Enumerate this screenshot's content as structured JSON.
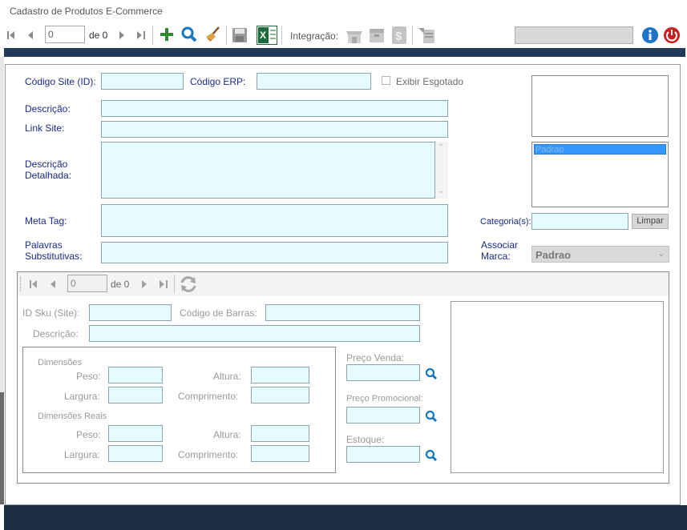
{
  "window": {
    "title": "Cadastro de Produtos E-Commerce"
  },
  "toolbar": {
    "record_value": "0",
    "record_of": "de 0",
    "integration_label": "Integração:"
  },
  "form": {
    "codigo_site_label": "Código Site (ID):",
    "codigo_erp_label": "Código ERP:",
    "exibir_esgotado_label": "Exibir Esgotado",
    "descricao_label": "Descrição:",
    "link_site_label": "Link Site:",
    "descricao_detalhada_label": "Descrição\nDetalhada:",
    "meta_tag_label": "Meta Tag:",
    "palavras_label": "Palavras\nSubstitutivas:",
    "categorias_label": "Categoria(s):",
    "limpar_label": "Limpar",
    "associar_marca_label": "Associar\nMarca:",
    "marca_value": "Padrao",
    "category_list": [
      "Padrao"
    ]
  },
  "sku": {
    "record_value": "0",
    "record_of": "de 0",
    "id_sku_label": "ID Sku (Site):",
    "codigo_barras_label": "Código de Barras:",
    "descricao_label": "Descrição:",
    "dimensoes_title": "Dimensões",
    "dimensoes_reais_title": "Dimensões Reais",
    "peso_label": "Peso:",
    "altura_label": "Altura:",
    "largura_label": "Largura:",
    "comprimento_label": "Comprimento:",
    "preco_venda_label": "Preço Venda:",
    "preco_promocional_label": "Preço Promocional:",
    "estoque_label": "Estoque:"
  },
  "colors": {
    "accent_bar": "#1f3a5c",
    "field_bg": "#e6fbfd",
    "label_blue": "#1a2a88",
    "list_selected": "#3399ff"
  }
}
